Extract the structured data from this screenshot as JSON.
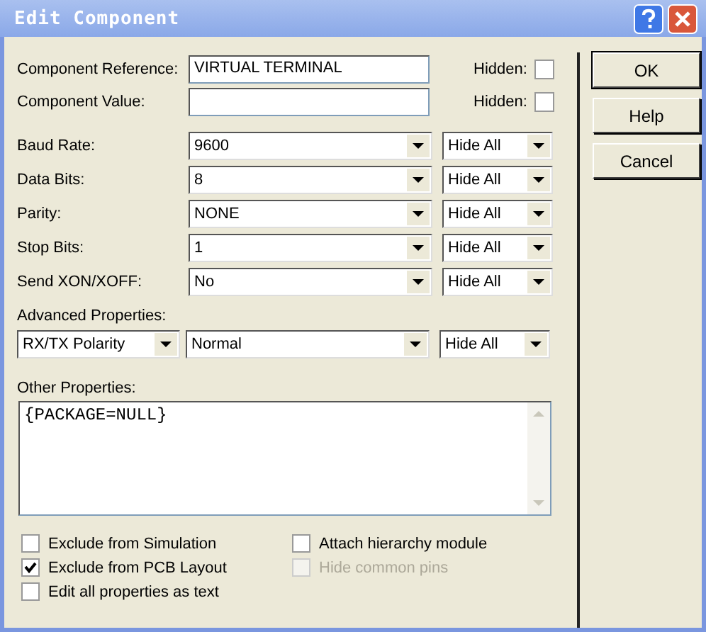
{
  "window": {
    "title": "Edit Component"
  },
  "fields": [
    {
      "label": "Component Reference:",
      "value": "VIRTUAL TERMINAL",
      "hidden_label": "Hidden:",
      "hidden": false
    },
    {
      "label": "Component Value:",
      "hidden_label": "Hidden:",
      "hidden": false
    }
  ],
  "properties": [
    {
      "label": "Baud Rate:",
      "value": "9600",
      "visibility": "Hide All"
    },
    {
      "label": "Data Bits:",
      "value": "8",
      "visibility": "Hide All"
    },
    {
      "label": "Parity:",
      "value": "NONE",
      "visibility": "Hide All"
    },
    {
      "label": "Stop Bits:",
      "value": "1",
      "visibility": "Hide All"
    },
    {
      "label": "Send XON/XOFF:",
      "value": "No",
      "visibility": "Hide All"
    }
  ],
  "advanced": {
    "label": "Advanced Properties:",
    "property": "RX/TX Polarity",
    "value": "Normal",
    "visibility": "Hide All"
  },
  "other": {
    "label": "Other Properties:",
    "text": "{PACKAGE=NULL}"
  },
  "options_left": [
    {
      "label": "Exclude from Simulation",
      "checked": false,
      "disabled": false
    },
    {
      "label": "Exclude from PCB Layout",
      "checked": true,
      "disabled": false
    },
    {
      "label": "Edit all properties as text",
      "checked": false,
      "disabled": false
    }
  ],
  "options_right": [
    {
      "label": "Attach hierarchy module",
      "checked": false,
      "disabled": false
    },
    {
      "label": "Hide common pins",
      "checked": false,
      "disabled": true
    }
  ],
  "buttons": [
    {
      "label": "OK",
      "default": true
    },
    {
      "label": "Help",
      "default": false
    },
    {
      "label": "Cancel",
      "default": false
    }
  ]
}
